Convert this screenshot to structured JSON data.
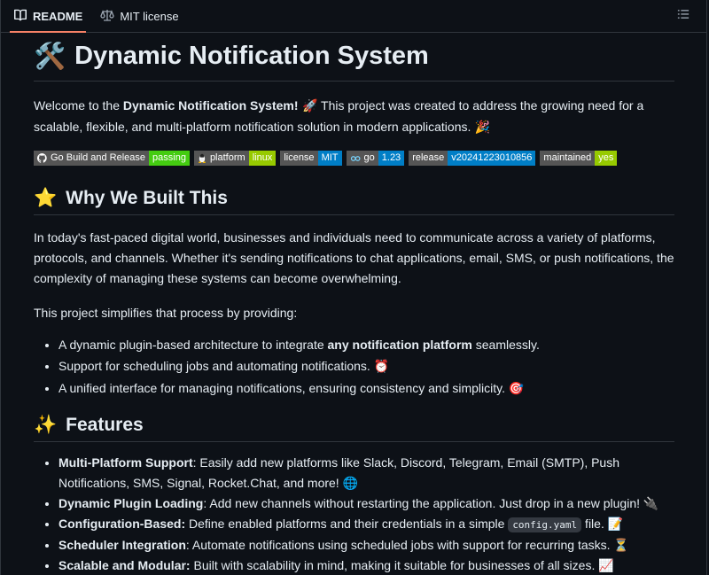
{
  "tabs": [
    {
      "label": "README",
      "icon": "book-icon",
      "active": true
    },
    {
      "label": "MIT license",
      "icon": "scale-icon",
      "active": false
    }
  ],
  "toc_icon": "list-icon",
  "title": {
    "emoji": "🛠️",
    "text": "Dynamic Notification System"
  },
  "intro": {
    "before": "Welcome to the ",
    "bold": "Dynamic Notification System!",
    "emoji1": " 🚀",
    "after": " This project was created to address the growing need for a scalable, flexible, and multi-platform notification solution in modern applications.",
    "emoji2": " 🎉"
  },
  "badges": [
    {
      "label": "Go Build and Release",
      "value": "passing",
      "color": "#4c1",
      "icon": "github-icon"
    },
    {
      "label": "platform",
      "value": "linux",
      "color": "#97ca00",
      "icon": "linux-icon"
    },
    {
      "label": "license",
      "value": "MIT",
      "color": "#007ec6",
      "icon": ""
    },
    {
      "label": "go",
      "value": "1.23",
      "color": "#007ec6",
      "icon": "go-icon"
    },
    {
      "label": "release",
      "value": "v20241223010856",
      "color": "#007ec6",
      "icon": ""
    },
    {
      "label": "maintained",
      "value": "yes",
      "color": "#97ca00",
      "icon": ""
    }
  ],
  "why": {
    "emoji": "⭐",
    "heading": "Why We Built This",
    "p1": "In today's fast-paced digital world, businesses and individuals need to communicate across a variety of platforms, protocols, and channels. Whether it's sending notifications to chat applications, email, SMS, or push notifications, the complexity of managing these systems can become overwhelming.",
    "p2": "This project simplifies that process by providing:",
    "items": [
      {
        "before": "A dynamic plugin-based architecture to integrate ",
        "bold": "any notification platform",
        "after": " seamlessly."
      },
      {
        "before": "Support for scheduling jobs and automating notifications. ",
        "bold": "",
        "after": "⏰"
      },
      {
        "before": "A unified interface for managing notifications, ensuring consistency and simplicity. ",
        "bold": "",
        "after": "🎯"
      }
    ]
  },
  "features": {
    "emoji": "✨",
    "heading": "Features",
    "items": [
      {
        "bold": "Multi-Platform Support",
        "text": ": Easily add new platforms like Slack, Discord, Telegram, Email (SMTP), Push Notifications, SMS, Signal, Rocket.Chat, and more! 🌐",
        "code": "",
        "after": ""
      },
      {
        "bold": "Dynamic Plugin Loading",
        "text": ": Add new channels without restarting the application. Just drop in a new plugin! 🔌",
        "code": "",
        "after": ""
      },
      {
        "bold": "Configuration-Based:",
        "text": " Define enabled platforms and their credentials in a simple ",
        "code": "config.yaml",
        "after": " file. 📝"
      },
      {
        "bold": "Scheduler Integration",
        "text": ": Automate notifications using scheduled jobs with support for recurring tasks. ⏳",
        "code": "",
        "after": ""
      },
      {
        "bold": "Scalable and Modular:",
        "text": " Built with scalability in mind, making it suitable for businesses of all sizes. 📈",
        "code": "",
        "after": ""
      }
    ]
  }
}
